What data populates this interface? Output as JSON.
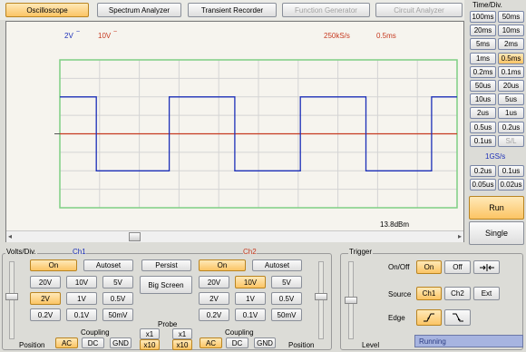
{
  "tabs": [
    {
      "label": "Oscilloscope",
      "selected": true,
      "enabled": true
    },
    {
      "label": "Spectrum Analyzer",
      "selected": false,
      "enabled": true
    },
    {
      "label": "Transient Recorder",
      "selected": false,
      "enabled": true
    },
    {
      "label": "Function Generator",
      "selected": false,
      "enabled": false
    },
    {
      "label": "Circuit Analyzer",
      "selected": false,
      "enabled": false
    }
  ],
  "timediv": {
    "title": "Time/Div.",
    "buttons": [
      [
        "100ms",
        "50ms"
      ],
      [
        "20ms",
        "10ms"
      ],
      [
        "5ms",
        "2ms"
      ],
      [
        "1ms",
        "0.5ms"
      ],
      [
        "0.2ms",
        "0.1ms"
      ],
      [
        "50us",
        "20us"
      ],
      [
        "10us",
        "5us"
      ],
      [
        "2us",
        "1us"
      ],
      [
        "0.5us",
        "0.2us"
      ],
      [
        "0.1us",
        "S/L"
      ]
    ],
    "selected": "0.5ms",
    "disabled": "S/L",
    "rate_label": "1GS/s",
    "fast_buttons": [
      [
        "0.2us",
        "0.1us"
      ],
      [
        "0.05us",
        "0.02us"
      ]
    ]
  },
  "run_label": "Run",
  "single_label": "Single",
  "screen": {
    "ch1_scale": "2V",
    "ch2_scale": "10V",
    "sample_rate": "250kS/s",
    "time_scale": "0.5ms",
    "power_readout": "13.8dBm"
  },
  "volts": {
    "title": "Volts/Div.",
    "ch1_title": "Ch1",
    "ch2_title": "Ch2",
    "on_label": "On",
    "autoset_label": "Autoset",
    "grid": [
      [
        "20V",
        "10V",
        "5V"
      ],
      [
        "2V",
        "1V",
        "0.5V"
      ],
      [
        "0.2V",
        "0.1V",
        "50mV"
      ]
    ],
    "ch1_selected": "2V",
    "ch2_selected": "10V",
    "persist_label": "Persist",
    "bigscreen_label": "Big Screen",
    "probe_label": "Probe",
    "probe_options": [
      "x1",
      "x10"
    ],
    "coupling_label": "Coupling",
    "coupling_options": [
      "AC",
      "DC",
      "GND"
    ],
    "position_label": "Position",
    "colors": {
      "ch1": "#1c2fb8",
      "ch2": "#c63a20"
    }
  },
  "trigger": {
    "title": "Trigger",
    "onoff_label": "On/Off",
    "on_label": "On",
    "off_label": "Off",
    "source_label": "Source",
    "sources": [
      "Ch1",
      "Ch2",
      "Ext"
    ],
    "edge_label": "Edge",
    "level_label": "Level",
    "status": "Running"
  },
  "chart_data": {
    "type": "line",
    "series": [
      {
        "name": "Ch1",
        "values": [
          2,
          2,
          -2,
          -2,
          2,
          2,
          -2,
          -2,
          2,
          2,
          -2,
          -2,
          2,
          2
        ]
      },
      {
        "name": "Ch2",
        "values": [
          0
        ]
      }
    ],
    "x": [
      0,
      0.5,
      0.5,
      1.5,
      1.5,
      2.4,
      2.4,
      3.3,
      3.3,
      4.2,
      4.2,
      5.1,
      5.1,
      5.45
    ]
  }
}
